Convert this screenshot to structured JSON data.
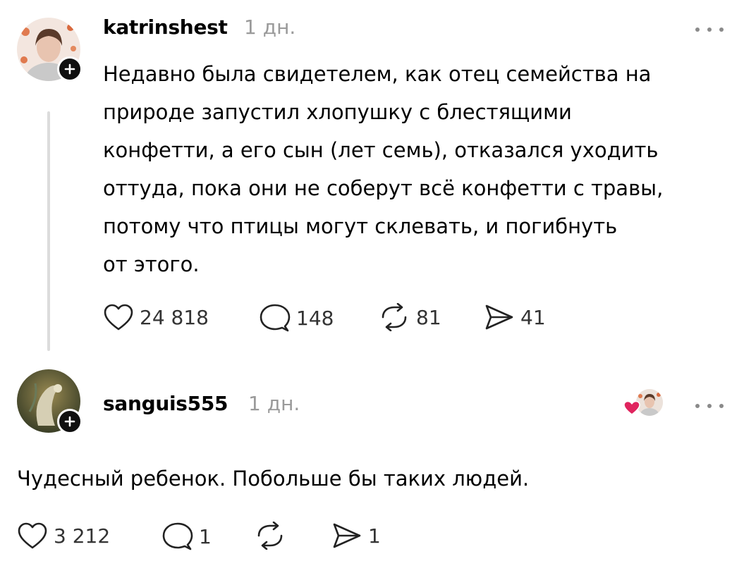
{
  "post": {
    "username": "katrinshest",
    "time": "1 дн.",
    "lines": [
      "Недавно была свидетелем, как отец семейства на",
      "природе запустил хлопушку с блестящими",
      "конфетти, а его сын (лет семь), отказался уходить",
      "оттуда, пока они не соберут всё конфетти с травы,",
      "потому что птицы могут склевать, и погибнуть",
      "от этого."
    ],
    "likes": "24 818",
    "comments": "148",
    "reposts": "81",
    "shares": "41"
  },
  "reply": {
    "username": "sanguis555",
    "time": "1 дн.",
    "text": "Чудесный ребенок. Побольше бы таких людей.",
    "likes": "3 212",
    "comments": "1",
    "shares": "1"
  },
  "colors": {
    "text": "#000000",
    "muted": "#9a9a9a",
    "like_heart": "#e0245e"
  },
  "icons": [
    "avatar-katrinshest",
    "follow-plus-icon",
    "more-icon",
    "heart-icon",
    "comment-icon",
    "repost-icon",
    "share-icon",
    "liked-by-author-icon"
  ]
}
